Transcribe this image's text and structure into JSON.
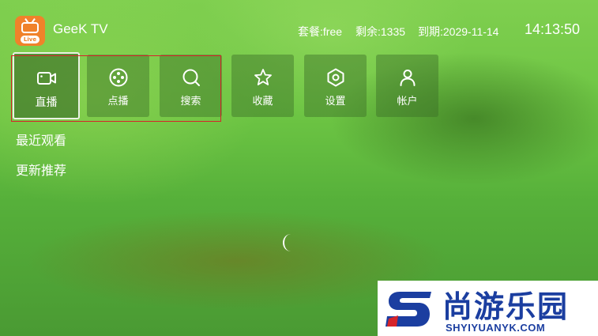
{
  "header": {
    "logo_badge": "Live",
    "app_title": "GeeK TV",
    "plan": "套餐:free",
    "remaining": "剩余:1335",
    "expiry": "到期:2029-11-14",
    "clock": "14:13:50"
  },
  "menu": [
    {
      "label": "直播",
      "icon": "video-camera-icon"
    },
    {
      "label": "点播",
      "icon": "film-reel-icon"
    },
    {
      "label": "搜索",
      "icon": "search-icon"
    },
    {
      "label": "收藏",
      "icon": "star-icon"
    },
    {
      "label": "设置",
      "icon": "hexagon-settings-icon"
    },
    {
      "label": "帐户",
      "icon": "user-icon"
    }
  ],
  "sections": {
    "recent": "最近观看",
    "update": "更新推荐"
  },
  "watermark": {
    "name": "尚游乐园",
    "url": "SHYIYUANYK.COM"
  },
  "colors": {
    "logo": "#f0822a",
    "highlight_box": "#d6242a",
    "watermark": "#1b3ea0"
  }
}
